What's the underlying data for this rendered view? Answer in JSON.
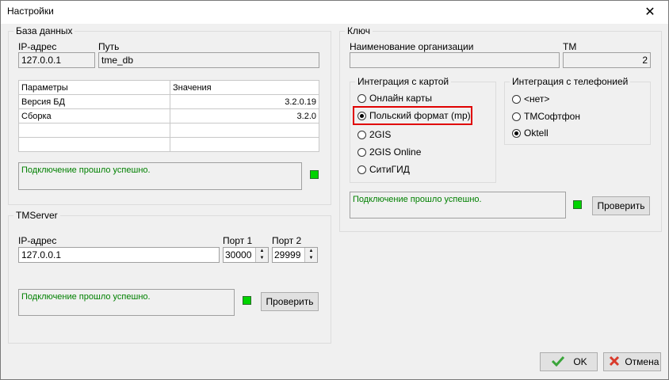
{
  "window": {
    "title": "Настройки",
    "close": "✕"
  },
  "db": {
    "legend": "База данных",
    "ip_label": "IP-адрес",
    "ip_value": "127.0.0.1",
    "path_label": "Путь",
    "path_value": "tme_db",
    "table": {
      "headers": [
        "Параметры",
        "Значения"
      ],
      "rows": [
        [
          "Версия БД",
          "3.2.0.19"
        ],
        [
          "Сборка",
          "3.2.0"
        ],
        [
          "",
          ""
        ],
        [
          "",
          ""
        ]
      ]
    },
    "status": "Подключение прошло успешно."
  },
  "tmserver": {
    "legend": "TMServer",
    "ip_label": "IP-адрес",
    "ip_value": "127.0.0.1",
    "port1_label": "Порт 1",
    "port1_value": "30000",
    "port2_label": "Порт 2",
    "port2_value": "29999",
    "status": "Подключение прошло успешно.",
    "check_button": "Проверить"
  },
  "key": {
    "legend": "Ключ",
    "org_label": "Наименование организации",
    "org_value": "",
    "tm_label": "TM",
    "tm_value": "2",
    "map_group": {
      "legend": "Интеграция с картой",
      "options": [
        "Онлайн карты",
        "Польский формат (mp)",
        "2GIS",
        "2GIS Online",
        "СитиГИД"
      ],
      "selected": "Польский формат (mp)"
    },
    "phone_group": {
      "legend": "Интеграция с телефонией",
      "options": [
        "<нет>",
        "ТМСофтфон",
        "Oktell"
      ],
      "selected": "Oktell"
    },
    "status": "Подключение прошло успешно.",
    "check_button": "Проверить"
  },
  "footer": {
    "ok": "OK",
    "cancel": "Отмена"
  },
  "colors": {
    "status_text": "#008000",
    "led": "#00d400",
    "highlight": "#e00000",
    "ok_icon": "#3aa53a",
    "cancel_icon": "#d93a2b"
  }
}
